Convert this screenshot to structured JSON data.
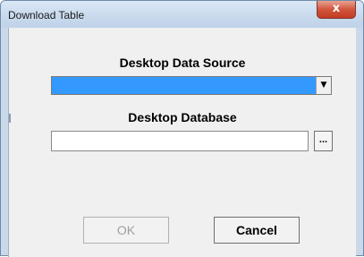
{
  "window": {
    "title": "Download Table",
    "close_glyph": "x"
  },
  "form": {
    "data_source_label": "Desktop Data Source",
    "data_source_value": "",
    "database_label": "Desktop Database",
    "database_value": "",
    "browse_label": "...",
    "dropdown_arrow": "▼"
  },
  "buttons": {
    "ok_label": "OK",
    "cancel_label": "Cancel"
  },
  "colors": {
    "selection": "#3399ff",
    "client_bg": "#f0f0f0",
    "frame": "#c9d9ea",
    "close_button": "#c13b21"
  }
}
